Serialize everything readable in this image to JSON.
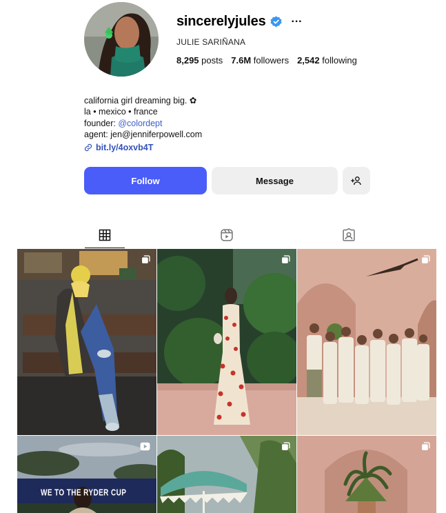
{
  "profile": {
    "username": "sincerelyjules",
    "full_name": "JULIE SARIÑANA",
    "more_label": "···",
    "stats": {
      "posts_count": "8,295",
      "posts_label": "posts",
      "followers_count": "7.6M",
      "followers_label": "followers",
      "following_count": "2,542",
      "following_label": "following"
    },
    "bio": {
      "line1": "california girl dreaming big. ✿",
      "line2": "la • mexico • france",
      "founder_prefix": "founder: ",
      "founder_handle": "@colordept",
      "line4": "agent: jen@jenniferpowell.com",
      "link": "bit.ly/4oxvb4T"
    }
  },
  "actions": {
    "follow_label": "Follow",
    "message_label": "Message"
  },
  "tabs": [
    {
      "icon": "grid-icon",
      "selected": true
    },
    {
      "icon": "reels-icon",
      "selected": false
    },
    {
      "icon": "tagged-icon",
      "selected": false
    }
  ],
  "posts": [
    {
      "type": "carousel",
      "subject": "woman in yellow beanie and scarf sitting on bench"
    },
    {
      "type": "carousel",
      "subject": "woman in polka dot dress in tropical garden"
    },
    {
      "type": "carousel",
      "subject": "group in white outfits under pink arches"
    },
    {
      "type": "reel",
      "subject": "ryder cup event",
      "caption": "WE TO THE RYDER CUP"
    },
    {
      "type": "carousel",
      "subject": "green umbrella and palm trees"
    },
    {
      "type": "carousel",
      "subject": "pink arch with plant"
    }
  ],
  "colors": {
    "accent": "#4a5df9",
    "verified": "#3897f0",
    "link": "#3150b8"
  }
}
